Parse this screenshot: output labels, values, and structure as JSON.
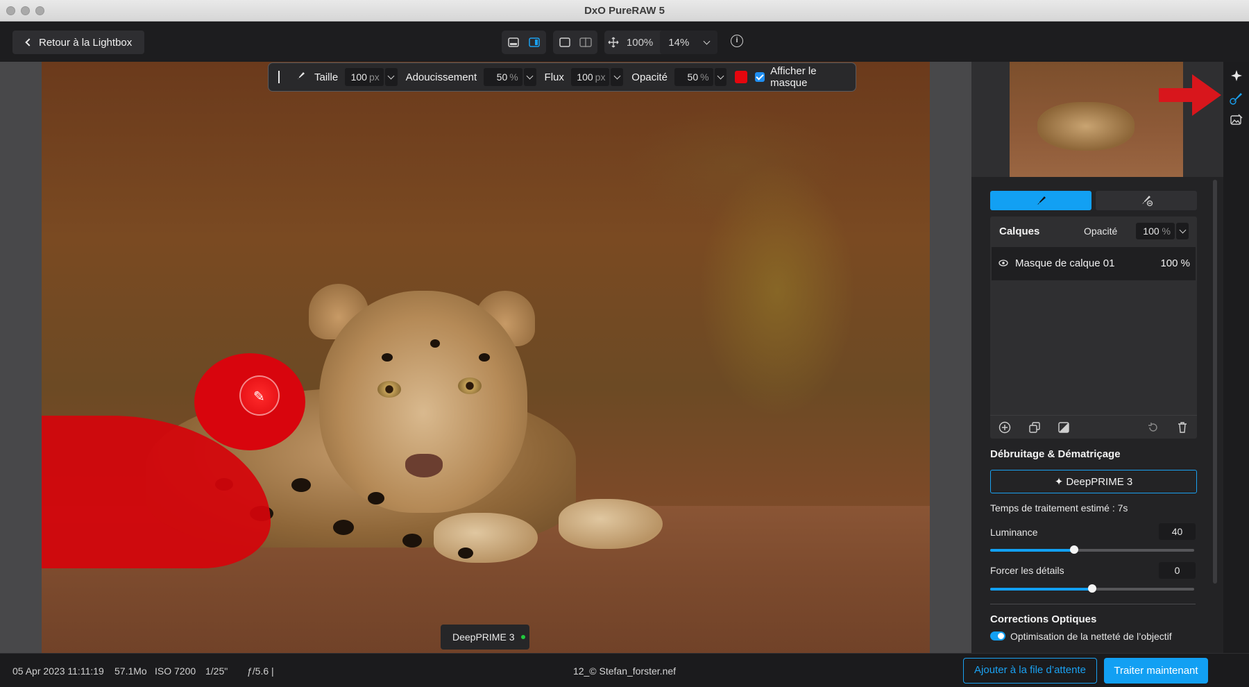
{
  "window": {
    "title": "DxO PureRAW 5"
  },
  "toolbar": {
    "back_label": "Retour à la Lightbox",
    "zoom_fit": "100%",
    "zoom_select": "14%"
  },
  "brush_bar": {
    "size_label": "Taille",
    "size_value": "100",
    "size_unit": "px",
    "softness_label": "Adoucissement",
    "softness_value": "50",
    "softness_unit": "%",
    "flow_label": "Flux",
    "flow_value": "100",
    "flow_unit": "px",
    "opacity_label": "Opacité",
    "opacity_value": "50",
    "opacity_unit": "%",
    "mask_color": "#e5060e",
    "show_mask_label": "Afficher le masque",
    "show_mask_checked": true
  },
  "canvas": {
    "engine_tag": "DeepPRIME 3"
  },
  "layers": {
    "title": "Calques",
    "opacity_label": "Opacité",
    "opacity_value": "100",
    "opacity_unit": "%",
    "items": [
      {
        "name": "Masque de calque 01",
        "opacity": "100 %"
      }
    ]
  },
  "denoise": {
    "section_title": "Débruitage & Dématriçage",
    "engine_button": "DeepPRIME 3",
    "estimated_time": "Temps de traitement estimé : 7s",
    "luminance_label": "Luminance",
    "luminance_value": "40",
    "luminance_level": 0.41,
    "details_label": "Forcer les détails",
    "details_value": "0",
    "details_level": 0.5
  },
  "optics": {
    "section_title": "Corrections Optiques",
    "lens_sharpness_label": "Optimisation de la netteté de l’objectif",
    "lens_sharpness_on": true
  },
  "status": {
    "date": "05 Apr 2023 11:11:19",
    "size": "57.1Mo",
    "iso": "ISO 7200",
    "shutter": "1/25\"",
    "aperture": "ƒ/5.6",
    "separator": "|",
    "filename": "12_© Stefan_forster.nef",
    "queue_button": "Ajouter à la file d’attente",
    "process_button": "Traiter maintenant"
  },
  "colors": {
    "accent": "#12a0f3",
    "mask_red": "#e5060e"
  }
}
